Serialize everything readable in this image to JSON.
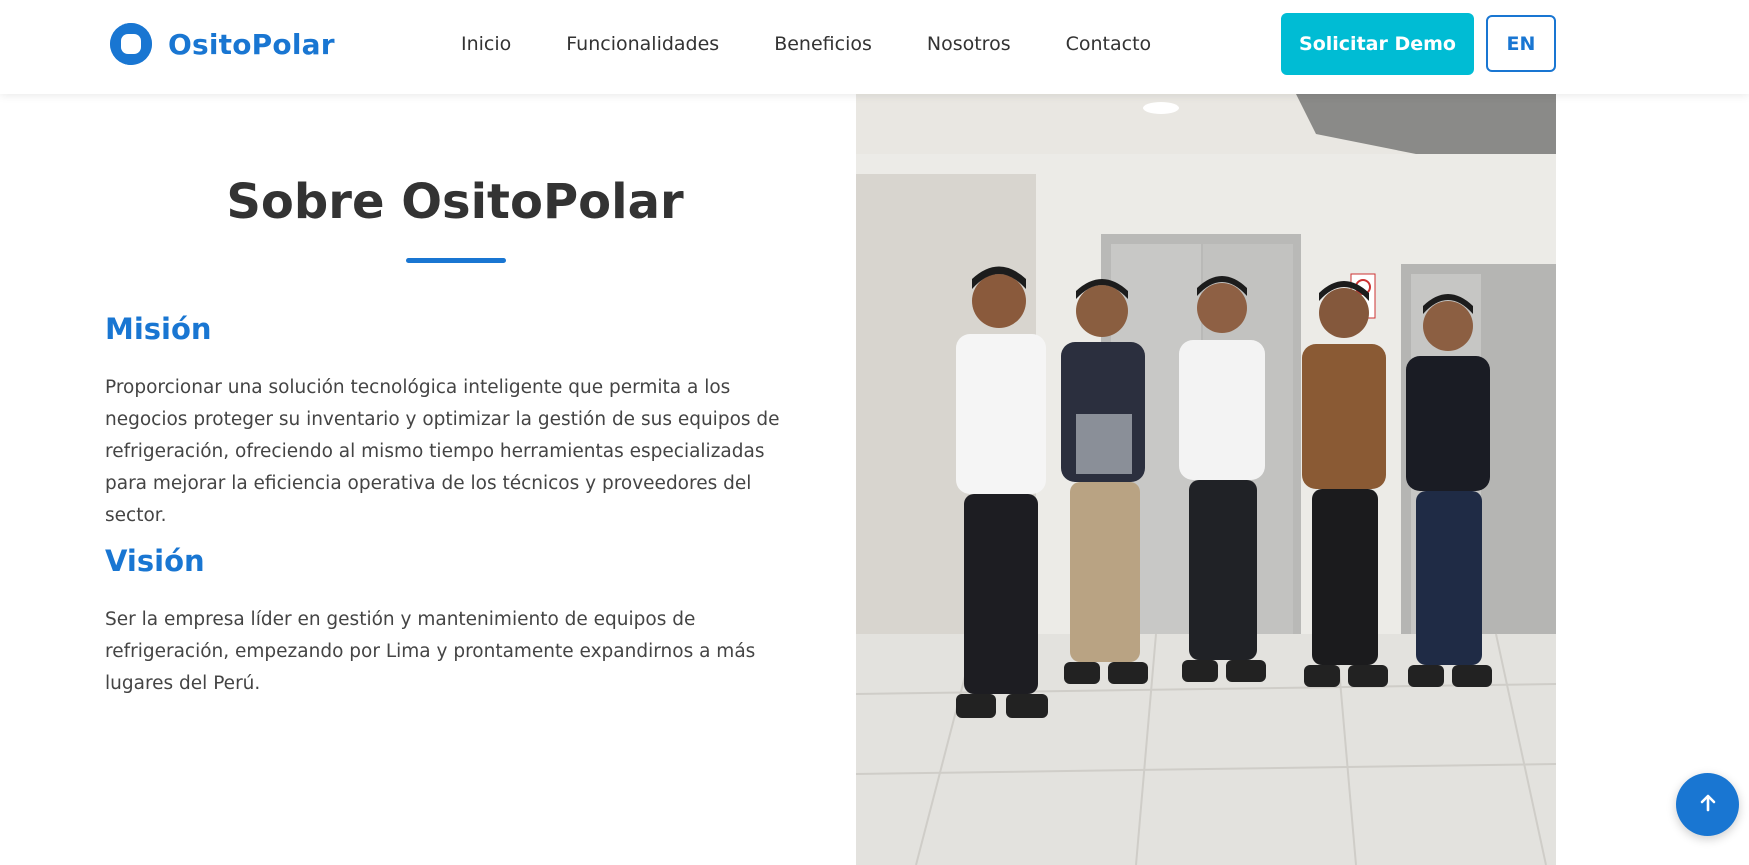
{
  "brand": {
    "name": "OsitoPolar",
    "logo_icon": "polar-ring-logo-icon",
    "color": "#1976d2"
  },
  "nav": {
    "items": [
      {
        "label": "Inicio"
      },
      {
        "label": "Funcionalidades"
      },
      {
        "label": "Beneficios"
      },
      {
        "label": "Nosotros"
      },
      {
        "label": "Contacto"
      }
    ]
  },
  "header": {
    "demo_button": "Solicitar Demo",
    "demo_button_color": "#00bcd4",
    "lang_button": "EN"
  },
  "about": {
    "title": "Sobre OsitoPolar",
    "mission": {
      "heading": "Misión",
      "text": "Proporcionar una solución tecnológica inteligente que permita a los negocios proteger su inventario y optimizar la gestión de sus equipos de refrigeración, ofreciendo al mismo tiempo herramientas especializadas para mejorar la eficiencia operativa de los técnicos y proveedores del sector."
    },
    "vision": {
      "heading": "Visión",
      "text": "Ser la empresa líder en gestión y mantenimiento de equipos de refrigeración, empezando por Lima y prontamente expandirnos a más lugares del Perú."
    }
  },
  "photo": {
    "icon": "team-photo"
  },
  "scroll_top": {
    "icon": "arrow-up-icon"
  }
}
